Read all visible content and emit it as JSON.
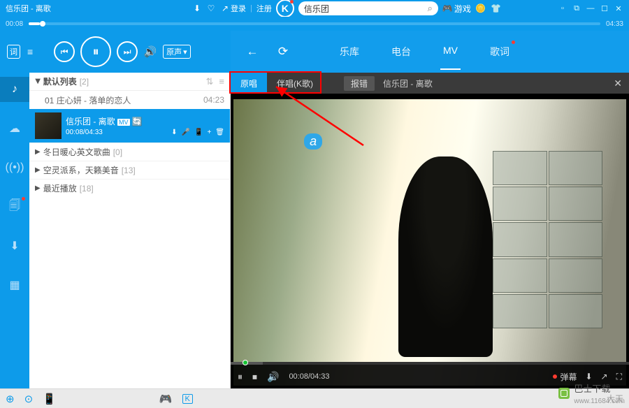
{
  "titlebar": {
    "now_playing": "信乐团 - 离歌",
    "login": "登录",
    "register": "注册",
    "search_value": "信乐团",
    "game_label": "游戏"
  },
  "progress": {
    "current": "00:08",
    "total": "04:33"
  },
  "player": {
    "lyric_btn": "词",
    "voice_mode": "原声"
  },
  "playlist": {
    "header": {
      "title": "默认列表",
      "count": "[2]"
    },
    "rows": [
      {
        "idx": "01",
        "title": "庄心妍 - 落单的恋人",
        "dur": "04:23"
      }
    ],
    "playing": {
      "title": "信乐团 - 离歌",
      "time": "00:08/04:33",
      "mv_badge": "MV"
    },
    "groups": [
      {
        "title": "冬日暖心英文歌曲",
        "count": "[0]"
      },
      {
        "title": "空灵派系，天籁美音",
        "count": "[13]"
      },
      {
        "title": "最近播放",
        "count": "[18]"
      }
    ]
  },
  "contentnav": {
    "tabs": [
      "乐库",
      "电台",
      "MV",
      "歌词"
    ],
    "active_index": 2
  },
  "mvbar": {
    "tab_original": "原唱",
    "tab_karaoke": "伴唱(K歌)",
    "report": "报错",
    "title": "信乐团 - 离歌"
  },
  "video": {
    "badge": "a",
    "danmu": "弹幕",
    "time": "00:08/04:33"
  },
  "bottom": {
    "status": "大天"
  },
  "watermark": {
    "name": "巴士下载",
    "url": "www.11684.com"
  }
}
